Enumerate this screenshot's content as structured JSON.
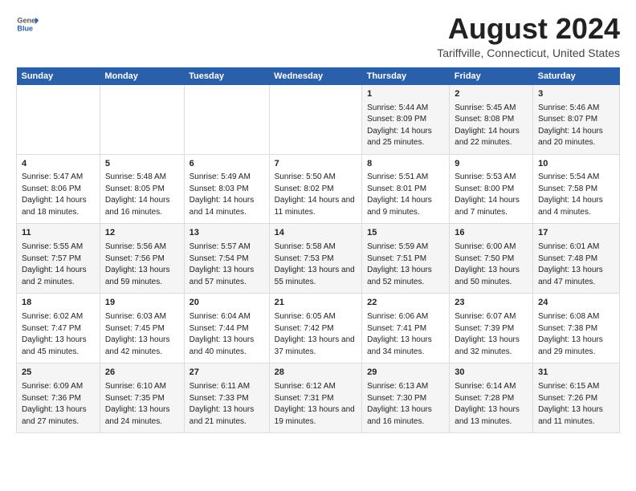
{
  "logo": {
    "general": "General",
    "blue": "Blue"
  },
  "title": "August 2024",
  "subtitle": "Tariffville, Connecticut, United States",
  "days_of_week": [
    "Sunday",
    "Monday",
    "Tuesday",
    "Wednesday",
    "Thursday",
    "Friday",
    "Saturday"
  ],
  "weeks": [
    [
      {
        "day": "",
        "info": ""
      },
      {
        "day": "",
        "info": ""
      },
      {
        "day": "",
        "info": ""
      },
      {
        "day": "",
        "info": ""
      },
      {
        "day": "1",
        "info": "Sunrise: 5:44 AM\nSunset: 8:09 PM\nDaylight: 14 hours and 25 minutes."
      },
      {
        "day": "2",
        "info": "Sunrise: 5:45 AM\nSunset: 8:08 PM\nDaylight: 14 hours and 22 minutes."
      },
      {
        "day": "3",
        "info": "Sunrise: 5:46 AM\nSunset: 8:07 PM\nDaylight: 14 hours and 20 minutes."
      }
    ],
    [
      {
        "day": "4",
        "info": "Sunrise: 5:47 AM\nSunset: 8:06 PM\nDaylight: 14 hours and 18 minutes."
      },
      {
        "day": "5",
        "info": "Sunrise: 5:48 AM\nSunset: 8:05 PM\nDaylight: 14 hours and 16 minutes."
      },
      {
        "day": "6",
        "info": "Sunrise: 5:49 AM\nSunset: 8:03 PM\nDaylight: 14 hours and 14 minutes."
      },
      {
        "day": "7",
        "info": "Sunrise: 5:50 AM\nSunset: 8:02 PM\nDaylight: 14 hours and 11 minutes."
      },
      {
        "day": "8",
        "info": "Sunrise: 5:51 AM\nSunset: 8:01 PM\nDaylight: 14 hours and 9 minutes."
      },
      {
        "day": "9",
        "info": "Sunrise: 5:53 AM\nSunset: 8:00 PM\nDaylight: 14 hours and 7 minutes."
      },
      {
        "day": "10",
        "info": "Sunrise: 5:54 AM\nSunset: 7:58 PM\nDaylight: 14 hours and 4 minutes."
      }
    ],
    [
      {
        "day": "11",
        "info": "Sunrise: 5:55 AM\nSunset: 7:57 PM\nDaylight: 14 hours and 2 minutes."
      },
      {
        "day": "12",
        "info": "Sunrise: 5:56 AM\nSunset: 7:56 PM\nDaylight: 13 hours and 59 minutes."
      },
      {
        "day": "13",
        "info": "Sunrise: 5:57 AM\nSunset: 7:54 PM\nDaylight: 13 hours and 57 minutes."
      },
      {
        "day": "14",
        "info": "Sunrise: 5:58 AM\nSunset: 7:53 PM\nDaylight: 13 hours and 55 minutes."
      },
      {
        "day": "15",
        "info": "Sunrise: 5:59 AM\nSunset: 7:51 PM\nDaylight: 13 hours and 52 minutes."
      },
      {
        "day": "16",
        "info": "Sunrise: 6:00 AM\nSunset: 7:50 PM\nDaylight: 13 hours and 50 minutes."
      },
      {
        "day": "17",
        "info": "Sunrise: 6:01 AM\nSunset: 7:48 PM\nDaylight: 13 hours and 47 minutes."
      }
    ],
    [
      {
        "day": "18",
        "info": "Sunrise: 6:02 AM\nSunset: 7:47 PM\nDaylight: 13 hours and 45 minutes."
      },
      {
        "day": "19",
        "info": "Sunrise: 6:03 AM\nSunset: 7:45 PM\nDaylight: 13 hours and 42 minutes."
      },
      {
        "day": "20",
        "info": "Sunrise: 6:04 AM\nSunset: 7:44 PM\nDaylight: 13 hours and 40 minutes."
      },
      {
        "day": "21",
        "info": "Sunrise: 6:05 AM\nSunset: 7:42 PM\nDaylight: 13 hours and 37 minutes."
      },
      {
        "day": "22",
        "info": "Sunrise: 6:06 AM\nSunset: 7:41 PM\nDaylight: 13 hours and 34 minutes."
      },
      {
        "day": "23",
        "info": "Sunrise: 6:07 AM\nSunset: 7:39 PM\nDaylight: 13 hours and 32 minutes."
      },
      {
        "day": "24",
        "info": "Sunrise: 6:08 AM\nSunset: 7:38 PM\nDaylight: 13 hours and 29 minutes."
      }
    ],
    [
      {
        "day": "25",
        "info": "Sunrise: 6:09 AM\nSunset: 7:36 PM\nDaylight: 13 hours and 27 minutes."
      },
      {
        "day": "26",
        "info": "Sunrise: 6:10 AM\nSunset: 7:35 PM\nDaylight: 13 hours and 24 minutes."
      },
      {
        "day": "27",
        "info": "Sunrise: 6:11 AM\nSunset: 7:33 PM\nDaylight: 13 hours and 21 minutes."
      },
      {
        "day": "28",
        "info": "Sunrise: 6:12 AM\nSunset: 7:31 PM\nDaylight: 13 hours and 19 minutes."
      },
      {
        "day": "29",
        "info": "Sunrise: 6:13 AM\nSunset: 7:30 PM\nDaylight: 13 hours and 16 minutes."
      },
      {
        "day": "30",
        "info": "Sunrise: 6:14 AM\nSunset: 7:28 PM\nDaylight: 13 hours and 13 minutes."
      },
      {
        "day": "31",
        "info": "Sunrise: 6:15 AM\nSunset: 7:26 PM\nDaylight: 13 hours and 11 minutes."
      }
    ]
  ]
}
